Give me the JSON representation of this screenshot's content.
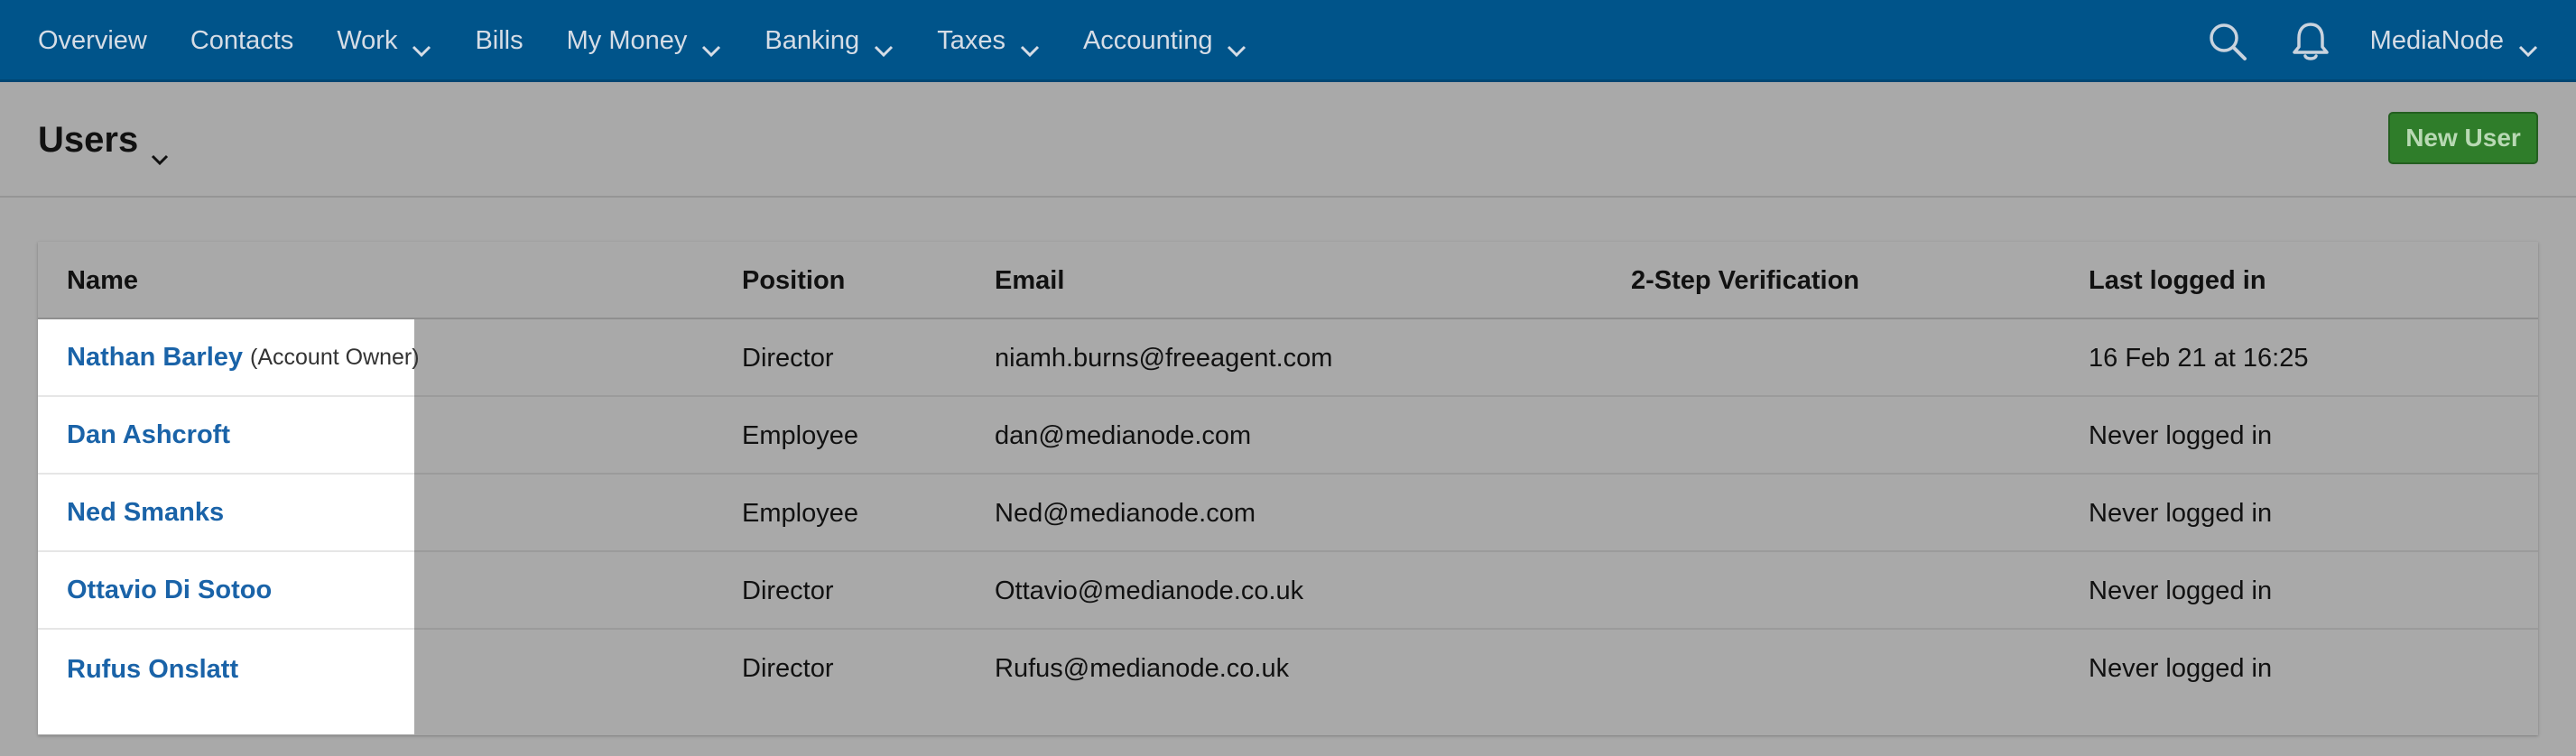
{
  "nav": {
    "items": [
      {
        "label": "Overview",
        "has_dropdown": false
      },
      {
        "label": "Contacts",
        "has_dropdown": false
      },
      {
        "label": "Work",
        "has_dropdown": true
      },
      {
        "label": "Bills",
        "has_dropdown": false
      },
      {
        "label": "My Money",
        "has_dropdown": true
      },
      {
        "label": "Banking",
        "has_dropdown": true
      },
      {
        "label": "Taxes",
        "has_dropdown": true
      },
      {
        "label": "Accounting",
        "has_dropdown": true
      }
    ],
    "search_icon": "search-icon",
    "notifications_icon": "bell-icon",
    "account_label": "MediaNode"
  },
  "header": {
    "title": "Users",
    "new_user_label": "New User"
  },
  "table": {
    "columns": {
      "name": "Name",
      "position": "Position",
      "email": "Email",
      "two_step": "2-Step Verification",
      "last_logged_in": "Last logged in"
    },
    "rows": [
      {
        "name": "Nathan Barley",
        "note": "(Account Owner)",
        "position": "Director",
        "email": "niamh.burns@freeagent.com",
        "two_step": "",
        "last_logged_in": "16 Feb 21 at 16:25"
      },
      {
        "name": "Dan Ashcroft",
        "note": "",
        "position": "Employee",
        "email": "dan@medianode.com",
        "two_step": "",
        "last_logged_in": "Never logged in"
      },
      {
        "name": "Ned Smanks",
        "note": "",
        "position": "Employee",
        "email": "Ned@medianode.com",
        "two_step": "",
        "last_logged_in": "Never logged in"
      },
      {
        "name": "Ottavio Di Sotoo",
        "note": "",
        "position": "Director",
        "email": "Ottavio@medianode.co.uk",
        "two_step": "",
        "last_logged_in": "Never logged in"
      },
      {
        "name": "Rufus Onslatt",
        "note": "",
        "position": "Director",
        "email": "Rufus@medianode.co.uk",
        "two_step": "",
        "last_logged_in": "Never logged in"
      }
    ]
  },
  "colors": {
    "nav_bg": "#00548a",
    "link": "#1a63a8",
    "primary_button": "#2f7d2a",
    "overlay_bg": "#a9a9a9"
  }
}
